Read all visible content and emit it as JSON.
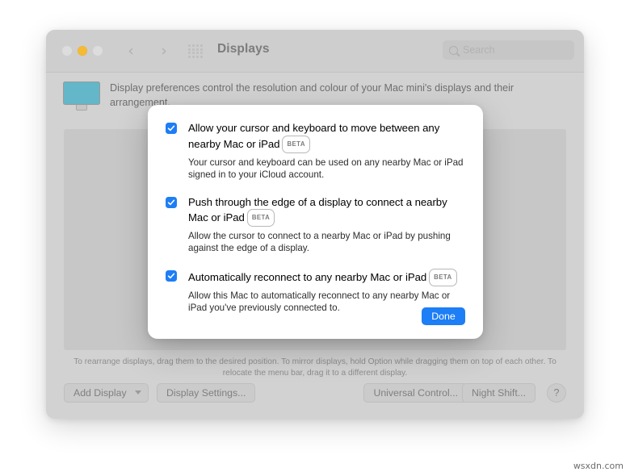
{
  "window": {
    "title": "Displays",
    "traffic_lights": [
      "close-button",
      "minimize-button",
      "zoom-button"
    ],
    "nav": {
      "back": "‹",
      "forward": "›"
    },
    "grid_icon": "grid-icon",
    "search": {
      "placeholder": "Search",
      "value": "",
      "icon": "search-icon"
    }
  },
  "main": {
    "display_icon": "display-monitor-icon",
    "description": "Display preferences control the resolution and colour of your Mac mini's displays and their arrangement.",
    "arrangement_hint": "To rearrange displays, drag them to the desired position. To mirror displays, hold Option while dragging them on top of each other. To relocate the menu bar, drag it to a different display."
  },
  "bottom_bar": {
    "add_display": "Add Display",
    "add_display_chevron": "chevron-down-icon",
    "display_settings": "Display Settings...",
    "universal_control": "Universal Control...",
    "night_shift": "Night Shift...",
    "help": "?"
  },
  "sheet": {
    "options": [
      {
        "checked": true,
        "title": "Allow your cursor and keyboard to move between any nearby Mac or iPad",
        "badge": "BETA",
        "description": "Your cursor and keyboard can be used on any nearby Mac or iPad signed in to your iCloud account."
      },
      {
        "checked": true,
        "title": "Push through the edge of a display to connect a nearby Mac or iPad",
        "badge": "BETA",
        "description": "Allow the cursor to connect to a nearby Mac or iPad by pushing against the edge of a display."
      },
      {
        "checked": true,
        "title": "Automatically reconnect to any nearby Mac or iPad",
        "badge": "BETA",
        "description": "Allow this Mac to automatically reconnect to any nearby Mac or iPad you've previously connected to."
      }
    ],
    "done_label": "Done"
  },
  "watermark": "wsxdn.com",
  "colors": {
    "accent_blue": "#1d7ef5",
    "display_teal": "#63b7c8",
    "minimize_yellow": "#f5bb33",
    "window_grey": "#d2d2d2"
  }
}
